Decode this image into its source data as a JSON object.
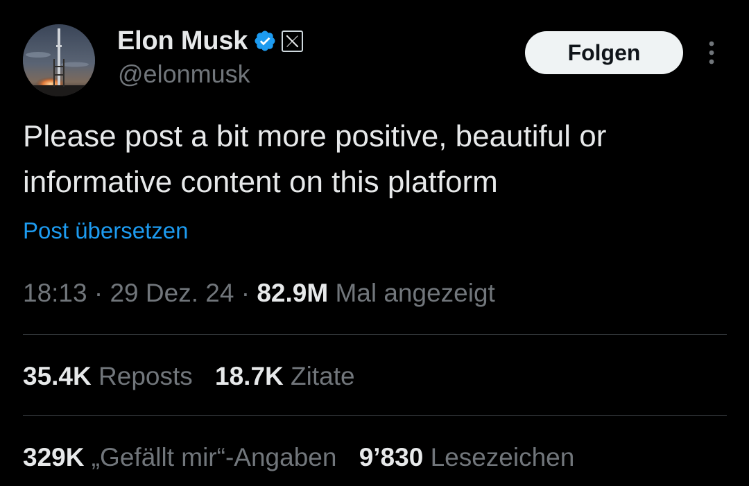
{
  "author": {
    "display_name": "Elon Musk",
    "handle": "@elonmusk",
    "avatar_icon": "rocket-launch-avatar",
    "verified_icon": "verified-badge-icon",
    "affiliate_icon": "x-logo-icon"
  },
  "follow_button": {
    "label": "Folgen"
  },
  "more_menu": {
    "icon": "more-vertical-icon"
  },
  "tweet": {
    "text": "Please post a bit more positive, beautiful or informative content on this platform",
    "translate_label": "Post übersetzen"
  },
  "meta": {
    "time": "18:13",
    "sep1": "·",
    "date": "29 Dez. 24",
    "sep2": "·",
    "views_count": "82.9M",
    "views_label": "Mal angezeigt"
  },
  "stats": {
    "reposts": {
      "count": "35.4K",
      "label": "Reposts"
    },
    "quotes": {
      "count": "18.7K",
      "label": "Zitate"
    },
    "likes": {
      "count": "329K",
      "label": "„Gefällt mir“-Angaben"
    },
    "bookmarks": {
      "count": "9’830",
      "label": "Lesezeichen"
    }
  },
  "colors": {
    "background": "#000000",
    "text_primary": "#e7e9ea",
    "text_secondary": "#71767b",
    "link": "#1d9bf0",
    "verified": "#1d9bf0",
    "divider": "#2f3336",
    "follow_bg": "#eff3f4"
  }
}
